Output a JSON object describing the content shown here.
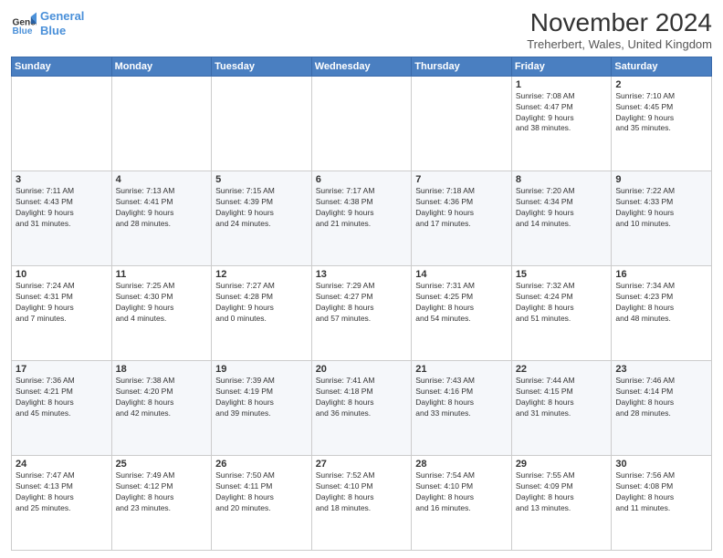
{
  "header": {
    "logo_line1": "General",
    "logo_line2": "Blue",
    "title": "November 2024",
    "subtitle": "Treherbert, Wales, United Kingdom"
  },
  "weekdays": [
    "Sunday",
    "Monday",
    "Tuesday",
    "Wednesday",
    "Thursday",
    "Friday",
    "Saturday"
  ],
  "weeks": [
    [
      {
        "day": "",
        "info": ""
      },
      {
        "day": "",
        "info": ""
      },
      {
        "day": "",
        "info": ""
      },
      {
        "day": "",
        "info": ""
      },
      {
        "day": "",
        "info": ""
      },
      {
        "day": "1",
        "info": "Sunrise: 7:08 AM\nSunset: 4:47 PM\nDaylight: 9 hours\nand 38 minutes."
      },
      {
        "day": "2",
        "info": "Sunrise: 7:10 AM\nSunset: 4:45 PM\nDaylight: 9 hours\nand 35 minutes."
      }
    ],
    [
      {
        "day": "3",
        "info": "Sunrise: 7:11 AM\nSunset: 4:43 PM\nDaylight: 9 hours\nand 31 minutes."
      },
      {
        "day": "4",
        "info": "Sunrise: 7:13 AM\nSunset: 4:41 PM\nDaylight: 9 hours\nand 28 minutes."
      },
      {
        "day": "5",
        "info": "Sunrise: 7:15 AM\nSunset: 4:39 PM\nDaylight: 9 hours\nand 24 minutes."
      },
      {
        "day": "6",
        "info": "Sunrise: 7:17 AM\nSunset: 4:38 PM\nDaylight: 9 hours\nand 21 minutes."
      },
      {
        "day": "7",
        "info": "Sunrise: 7:18 AM\nSunset: 4:36 PM\nDaylight: 9 hours\nand 17 minutes."
      },
      {
        "day": "8",
        "info": "Sunrise: 7:20 AM\nSunset: 4:34 PM\nDaylight: 9 hours\nand 14 minutes."
      },
      {
        "day": "9",
        "info": "Sunrise: 7:22 AM\nSunset: 4:33 PM\nDaylight: 9 hours\nand 10 minutes."
      }
    ],
    [
      {
        "day": "10",
        "info": "Sunrise: 7:24 AM\nSunset: 4:31 PM\nDaylight: 9 hours\nand 7 minutes."
      },
      {
        "day": "11",
        "info": "Sunrise: 7:25 AM\nSunset: 4:30 PM\nDaylight: 9 hours\nand 4 minutes."
      },
      {
        "day": "12",
        "info": "Sunrise: 7:27 AM\nSunset: 4:28 PM\nDaylight: 9 hours\nand 0 minutes."
      },
      {
        "day": "13",
        "info": "Sunrise: 7:29 AM\nSunset: 4:27 PM\nDaylight: 8 hours\nand 57 minutes."
      },
      {
        "day": "14",
        "info": "Sunrise: 7:31 AM\nSunset: 4:25 PM\nDaylight: 8 hours\nand 54 minutes."
      },
      {
        "day": "15",
        "info": "Sunrise: 7:32 AM\nSunset: 4:24 PM\nDaylight: 8 hours\nand 51 minutes."
      },
      {
        "day": "16",
        "info": "Sunrise: 7:34 AM\nSunset: 4:23 PM\nDaylight: 8 hours\nand 48 minutes."
      }
    ],
    [
      {
        "day": "17",
        "info": "Sunrise: 7:36 AM\nSunset: 4:21 PM\nDaylight: 8 hours\nand 45 minutes."
      },
      {
        "day": "18",
        "info": "Sunrise: 7:38 AM\nSunset: 4:20 PM\nDaylight: 8 hours\nand 42 minutes."
      },
      {
        "day": "19",
        "info": "Sunrise: 7:39 AM\nSunset: 4:19 PM\nDaylight: 8 hours\nand 39 minutes."
      },
      {
        "day": "20",
        "info": "Sunrise: 7:41 AM\nSunset: 4:18 PM\nDaylight: 8 hours\nand 36 minutes."
      },
      {
        "day": "21",
        "info": "Sunrise: 7:43 AM\nSunset: 4:16 PM\nDaylight: 8 hours\nand 33 minutes."
      },
      {
        "day": "22",
        "info": "Sunrise: 7:44 AM\nSunset: 4:15 PM\nDaylight: 8 hours\nand 31 minutes."
      },
      {
        "day": "23",
        "info": "Sunrise: 7:46 AM\nSunset: 4:14 PM\nDaylight: 8 hours\nand 28 minutes."
      }
    ],
    [
      {
        "day": "24",
        "info": "Sunrise: 7:47 AM\nSunset: 4:13 PM\nDaylight: 8 hours\nand 25 minutes."
      },
      {
        "day": "25",
        "info": "Sunrise: 7:49 AM\nSunset: 4:12 PM\nDaylight: 8 hours\nand 23 minutes."
      },
      {
        "day": "26",
        "info": "Sunrise: 7:50 AM\nSunset: 4:11 PM\nDaylight: 8 hours\nand 20 minutes."
      },
      {
        "day": "27",
        "info": "Sunrise: 7:52 AM\nSunset: 4:10 PM\nDaylight: 8 hours\nand 18 minutes."
      },
      {
        "day": "28",
        "info": "Sunrise: 7:54 AM\nSunset: 4:10 PM\nDaylight: 8 hours\nand 16 minutes."
      },
      {
        "day": "29",
        "info": "Sunrise: 7:55 AM\nSunset: 4:09 PM\nDaylight: 8 hours\nand 13 minutes."
      },
      {
        "day": "30",
        "info": "Sunrise: 7:56 AM\nSunset: 4:08 PM\nDaylight: 8 hours\nand 11 minutes."
      }
    ]
  ]
}
